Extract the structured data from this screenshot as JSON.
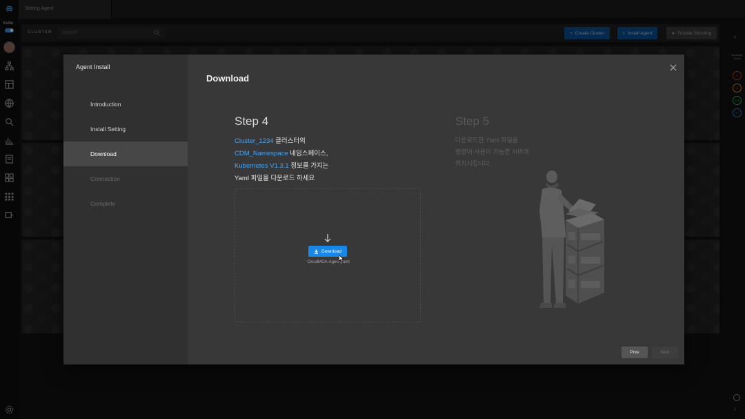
{
  "app": {
    "brand_label": "Kubo",
    "tab_title": "Setting Agent"
  },
  "cluster_bar": {
    "label": "CLUSTER",
    "search_placeholder": "Search",
    "buttons": {
      "create_cluster": "Create Cluster",
      "install_agent": "Install Agent",
      "trouble_shooting": "Trouble Shooting"
    }
  },
  "right_rail": {
    "label": "Anomaly Score",
    "badges": [
      "0",
      "5",
      "145",
      "87"
    ],
    "badge_colors": [
      "#c0392b",
      "#e67e22",
      "#27ae60",
      "#2980b9"
    ]
  },
  "modal": {
    "title": "Agent Install",
    "heading": "Download",
    "steps": [
      {
        "label": "Introduction",
        "state": "done"
      },
      {
        "label": "Install Setting",
        "state": "done"
      },
      {
        "label": "Download",
        "state": "active"
      },
      {
        "label": "Connection",
        "state": "todo"
      },
      {
        "label": "Complete",
        "state": "todo"
      }
    ],
    "step4": {
      "title": "Step 4",
      "cluster_name": "Cluster_1234",
      "line1_suffix": " 클러스터의",
      "namespace": "CDM_Namespace",
      "line2_suffix": " 네임스페이스,",
      "k8s_version": "Kubernetes V1.3.1",
      "line3_suffix": " 정보를 가지는",
      "line4": "Yaml 파일을 다운로드 하세요",
      "download_label": "Download",
      "file_name": "CloudMOA-Agent.yaml"
    },
    "step5": {
      "title": "Step 5",
      "line1": "다운로드한 Yaml 파일을",
      "line2": "명령어 사용이 가능한 서버에",
      "line3": "위치시킵니다."
    },
    "footer": {
      "prev_label": "Prev",
      "next_label": "Next"
    }
  },
  "colors": {
    "accent": "#1787e8",
    "highlight": "#4aa3f0",
    "modal_bg": "#383838",
    "sidebar_bg": "#303030"
  }
}
